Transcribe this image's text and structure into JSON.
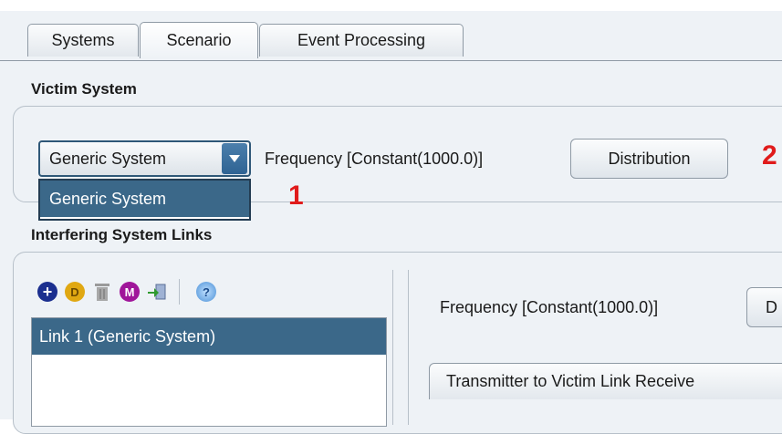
{
  "tabs": [
    {
      "label": "Systems"
    },
    {
      "label": "Scenario"
    },
    {
      "label": "Event Processing"
    }
  ],
  "victim": {
    "title": "Victim System",
    "combo_value": "Generic System",
    "dropdown_option": "Generic System",
    "frequency": "Frequency [Constant(1000.0)]",
    "distribution_button": "Distribution",
    "marker_1": "1",
    "marker_2": "2"
  },
  "interfering": {
    "title": "Interfering System Links",
    "toolbar_icons": [
      "add-icon",
      "duplicate-icon",
      "delete-icon",
      "merge-icon",
      "import-icon",
      "help-icon"
    ],
    "list_items": [
      "Link 1 (Generic System)"
    ],
    "frequency": "Frequency [Constant(1000.0)]",
    "distribution_button_partial": "D",
    "subtab": "Transmitter to Victim Link Receive"
  },
  "colors": {
    "selection": "#3b6889",
    "marker_red": "#e01b1b",
    "background": "#eef2f6"
  }
}
